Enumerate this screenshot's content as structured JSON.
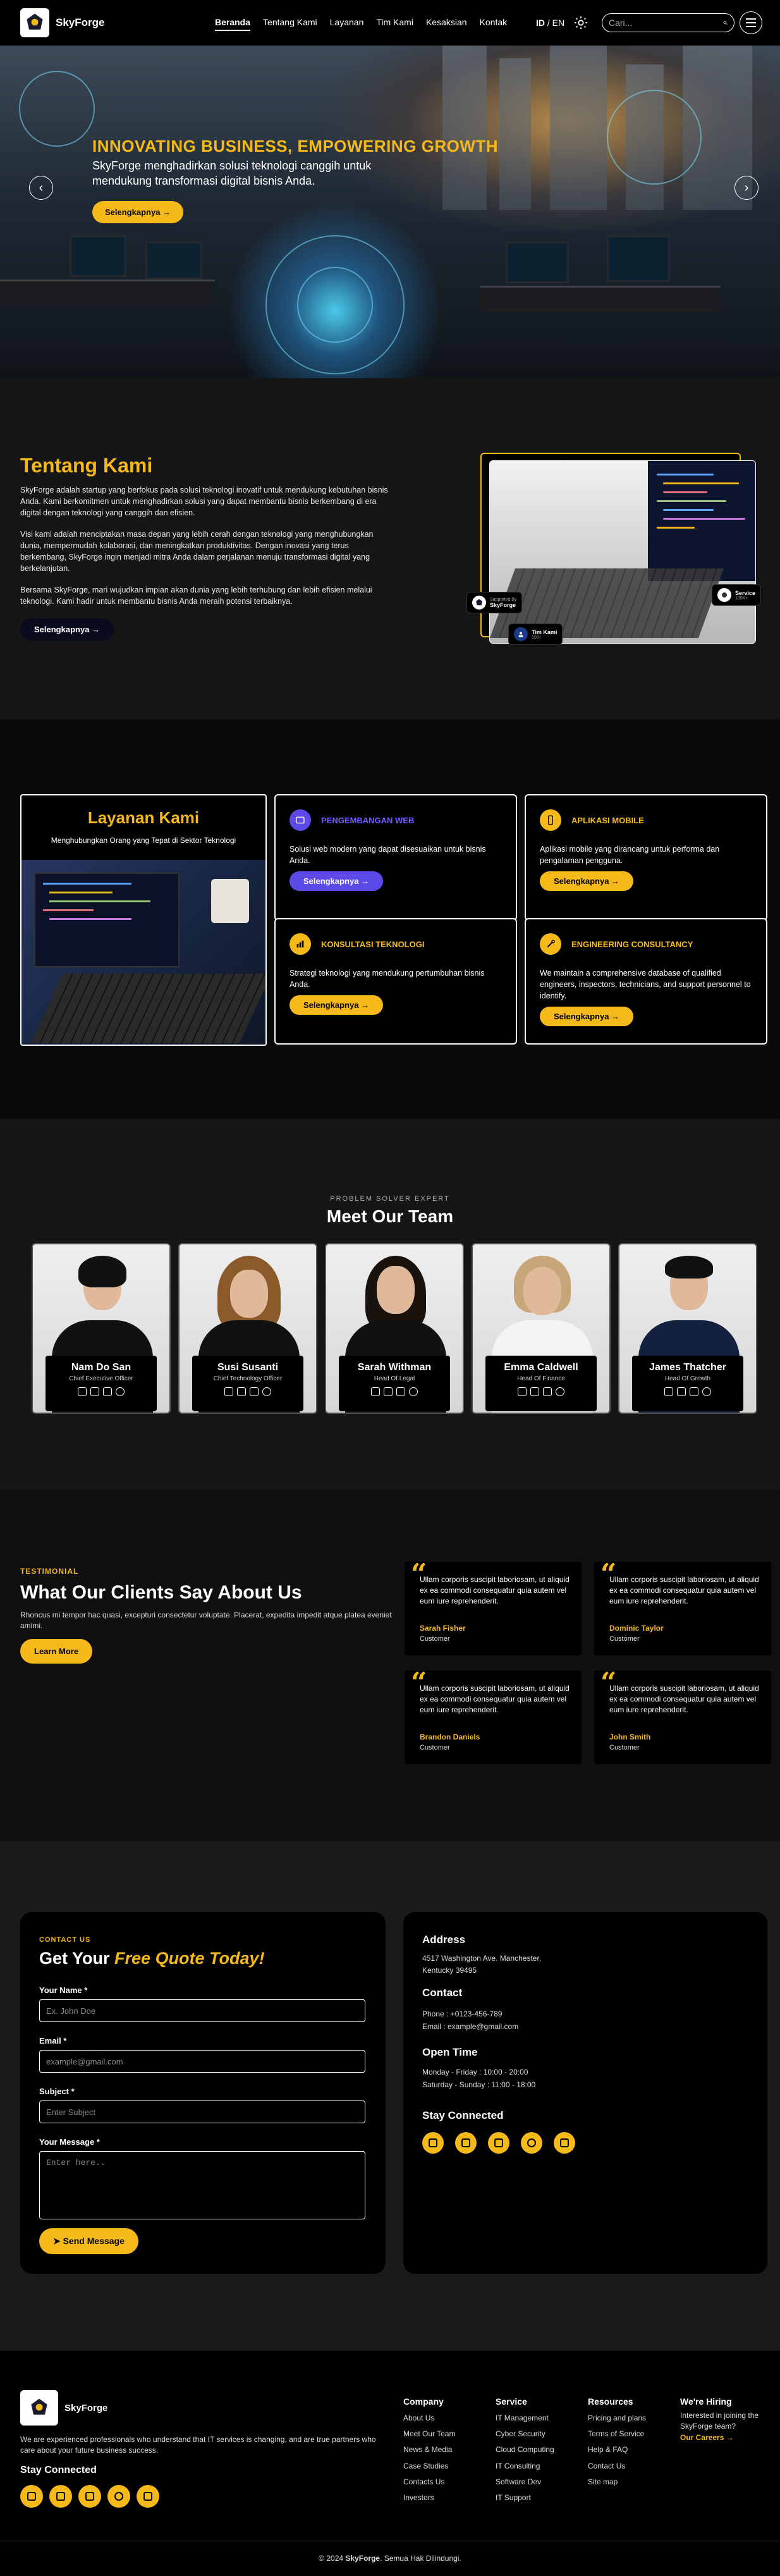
{
  "brand": {
    "name": "SkyForge"
  },
  "nav": {
    "items": [
      "Beranda",
      "Tentang Kami",
      "Layanan",
      "Tim Kami",
      "Kesaksian",
      "Kontak"
    ],
    "lang_id": "ID",
    "lang_sep": "/",
    "lang_en": "EN",
    "search_placeholder": "Cari..."
  },
  "hero": {
    "title": "INNOVATING BUSINESS, EMPOWERING GROWTH",
    "subtitle": "SkyForge menghadirkan solusi teknologi canggih untuk mendukung transformasi digital bisnis Anda.",
    "button": "Selengkapnya →"
  },
  "about": {
    "title": "Tentang Kami",
    "p1": "SkyForge adalah startup yang berfokus pada solusi teknologi inovatif untuk mendukung kebutuhan bisnis Anda. Kami berkomitmen untuk menghadirkan solusi yang dapat membantu bisnis berkembang di era digital dengan teknologi yang canggih dan efisien.",
    "p2": "Visi kami adalah menciptakan masa depan yang lebih cerah dengan teknologi yang menghubungkan dunia, mempermudah kolaborasi, dan meningkatkan produktivitas. Dengan inovasi yang terus berkembang, SkyForge ingin menjadi mitra Anda dalam perjalanan menuju transformasi digital yang berkelanjutan.",
    "p3": "Bersama SkyForge, mari wujudkan impian akan dunia yang lebih terhubung dan lebih efisien melalui teknologi. Kami hadir untuk membantu bisnis Anda meraih potensi terbaiknya.",
    "button": "Selengkapnya →",
    "badge1_top": "Supported By",
    "badge1_name": "SkyForge",
    "badge2_name": "Service",
    "badge2_sub": "100K+",
    "badge3_name": "Tim Kami",
    "badge3_sub": "100+"
  },
  "services": {
    "title": "Layanan Kami",
    "subtitle": "Menghubungkan Orang yang Tepat di Sektor Teknologi",
    "cards": [
      {
        "title": "PENGEMBANGAN WEB",
        "desc": "Solusi web modern yang dapat disesuaikan untuk bisnis Anda.",
        "button": "Selengkapnya →"
      },
      {
        "title": "APLIKASI MOBILE",
        "desc": "Aplikasi mobile yang dirancang untuk performa dan pengalaman pengguna.",
        "button": "Selengkapnya →"
      },
      {
        "title": "KONSULTASI TEKNOLOGI",
        "desc": "Strategi teknologi yang mendukung pertumbuhan bisnis Anda.",
        "button": "Selengkapnya →"
      },
      {
        "title": "ENGINEERING CONSULTANCY",
        "desc": "We maintain a comprehensive database of qualified engineers, inspectors, technicians, and support personnel to identify.",
        "button": "Selengkapnya →"
      }
    ]
  },
  "team": {
    "eyebrow": "PROBLEM SOLVER EXPERT",
    "title": "Meet Our Team",
    "members": [
      {
        "name": "Nam Do San",
        "role": "Chief Executive Officer"
      },
      {
        "name": "Susi Susanti",
        "role": "Chief Technology Officer"
      },
      {
        "name": "Sarah Withman",
        "role": "Head Of Legal"
      },
      {
        "name": "Emma Caldwell",
        "role": "Head Of Finance"
      },
      {
        "name": "James Thatcher",
        "role": "Head Of Growth"
      }
    ]
  },
  "testimonial": {
    "eyebrow": "TESTIMONIAL",
    "title": "What Our Clients Say About Us",
    "desc": "Rhoncus mi tempor hac quasi, excepturi consectetur voluptate. Placerat, expedita impedit atque platea eveniet amimi.",
    "button": "Learn More",
    "items": [
      {
        "text": "Ullam corporis suscipit laboriosam, ut aliquid ex ea commodi consequatur quia autem vel eum iure reprehenderit.",
        "name": "Sarah Fisher",
        "role": "Customer"
      },
      {
        "text": "Ullam corporis suscipit laboriosam, ut aliquid ex ea commodi consequatur quia autem vel eum iure reprehenderit.",
        "name": "Dominic Taylor",
        "role": "Customer"
      },
      {
        "text": "Ullam corporis suscipit laboriosam, ut aliquid ex ea commodi consequatur quia autem vel eum iure reprehenderit.",
        "name": "Brandon Daniels",
        "role": "Customer"
      },
      {
        "text": "Ullam corporis suscipit laboriosam, ut aliquid ex ea commodi consequatur quia autem vel eum iure reprehenderit.",
        "name": "John Smith",
        "role": "Customer"
      }
    ]
  },
  "contact": {
    "eyebrow": "CONTACT US",
    "title_a": "Get Your ",
    "title_b": "Free Quote Today!",
    "name_label": "Your Name *",
    "name_ph": "Ex. John Doe",
    "email_label": "Email *",
    "email_ph": "example@gmail.com",
    "subject_label": "Subject *",
    "subject_ph": "Enter Subject",
    "message_label": "Your Message *",
    "message_ph": "Enter here..",
    "send": "Send Message",
    "address_h": "Address",
    "address": "4517 Washington Ave. Manchester, Kentucky 39495",
    "contact_h": "Contact",
    "phone": "Phone : +0123-456-789",
    "email": "Email : example@gmail.com",
    "open_h": "Open Time",
    "open1": "Monday - Friday : 10:00 - 20:00",
    "open2": "Saturday - Sunday : 11:00 - 18:00",
    "stay": "Stay Connected"
  },
  "footer": {
    "desc": "We are experienced professionals who understand that IT services is changing, and are true partners who care about your future business success.",
    "stay": "Stay Connected",
    "company_h": "Company",
    "company": [
      "About Us",
      "Meet Our Team",
      "News & Media",
      "Case Studies",
      "Contacts Us",
      "Investors"
    ],
    "service_h": "Service",
    "service": [
      "IT Management",
      "Cyber Security",
      "Cloud Computing",
      "IT Consulting",
      "Software Dev",
      "IT Support"
    ],
    "resources_h": "Resources",
    "resources": [
      "Pricing and plans",
      "Terms of Service",
      "Help & FAQ",
      "Contact Us",
      "Site map"
    ],
    "hiring_h": "We're Hiring",
    "hiring_text": "Interested in joining the SkyForge team?",
    "careers": "Our Careers →",
    "copy_a": "© 2024 ",
    "copy_b": "SkyForge",
    "copy_c": ". Semua Hak Dilindungi."
  },
  "colors": {
    "accent": "#f5b91a",
    "web_icon": "#5b4ae8"
  }
}
